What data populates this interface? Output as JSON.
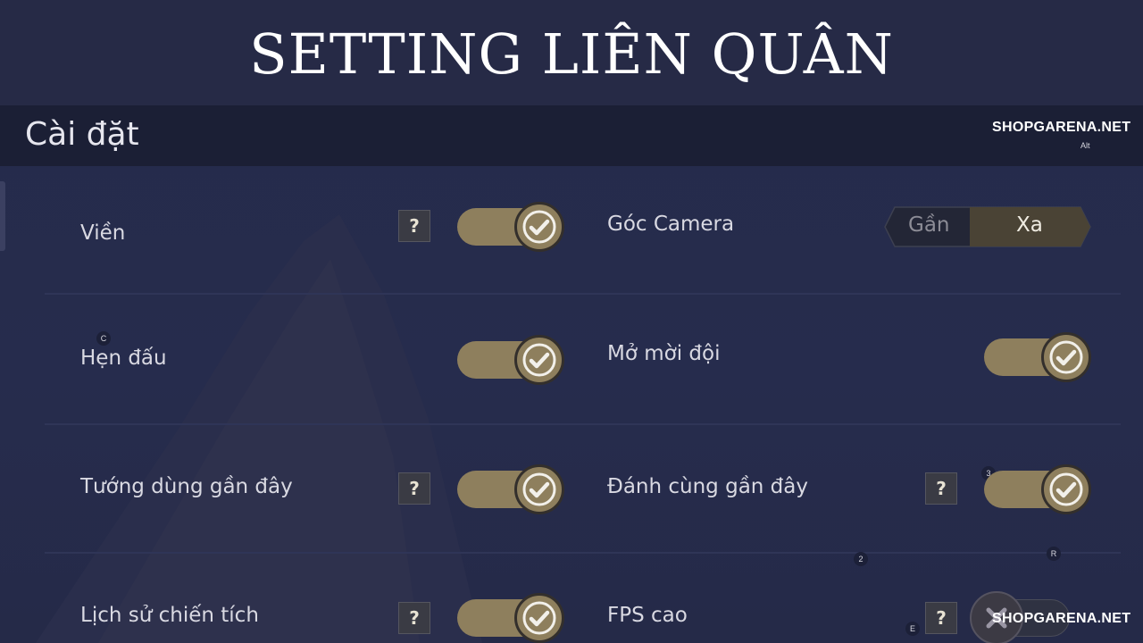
{
  "banner": {
    "title": "SETTING LIÊN QUÂN"
  },
  "header": {
    "title": "Cài đặt"
  },
  "watermark": {
    "top": "SHOPGARENA.NET",
    "top_sub": "Alt",
    "bottom": "SHOPGARENA.NET"
  },
  "keyhints": [
    "C",
    "3",
    "2",
    "R",
    "E"
  ],
  "settings": {
    "vien": {
      "label": "Viền",
      "help": "?",
      "enabled": true
    },
    "goc_camera": {
      "label": "Góc Camera",
      "options": [
        "Gần",
        "Xa"
      ],
      "selected": "Xa"
    },
    "hen_dau": {
      "label": "Hẹn đấu",
      "enabled": true
    },
    "mo_moi_doi": {
      "label": "Mở mời đội",
      "enabled": true
    },
    "tuong_dung": {
      "label": "Tướng dùng gần đây",
      "help": "?",
      "enabled": true
    },
    "danh_cung": {
      "label": "Đánh cùng gần đây",
      "help": "?",
      "enabled": true
    },
    "lich_su": {
      "label": "Lịch sử chiến tích",
      "help": "?",
      "enabled": true
    },
    "fps_cao": {
      "label": "FPS cao",
      "help": "?",
      "enabled": false
    }
  },
  "colors": {
    "toggle_on": "#8e7f5d",
    "checkmark": "#f2f0ea",
    "background": "#262c4d",
    "segment_active": "#4a4335"
  }
}
